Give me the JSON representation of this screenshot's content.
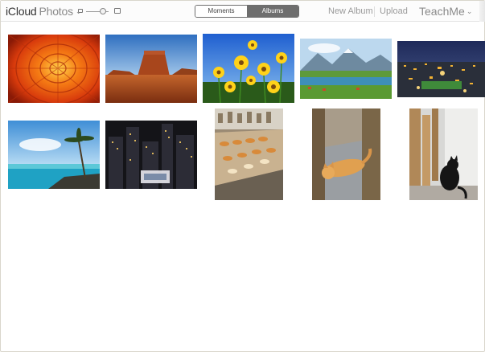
{
  "header": {
    "brand": "iCloud",
    "app_name": "Photos",
    "tabs": [
      {
        "label": "Moments",
        "selected": false
      },
      {
        "label": "Albums",
        "selected": true
      }
    ],
    "new_album_label": "New Album",
    "upload_label": "Upload",
    "user_name": "TeachMe"
  },
  "photos": [
    {
      "subject": "orange dahlia flower"
    },
    {
      "subject": "desert butte"
    },
    {
      "subject": "yellow wildflowers"
    },
    {
      "subject": "mountain lake valley"
    },
    {
      "subject": "city night skyline"
    },
    {
      "subject": "tropical beach palm"
    },
    {
      "subject": "city buildings at night"
    },
    {
      "subject": "bakery pastry counter"
    },
    {
      "subject": "orange cat on floor"
    },
    {
      "subject": "black cat in corner"
    }
  ],
  "colors": {
    "accent_selected": "#6e6e6e",
    "link_gray": "#9a9a9a"
  }
}
